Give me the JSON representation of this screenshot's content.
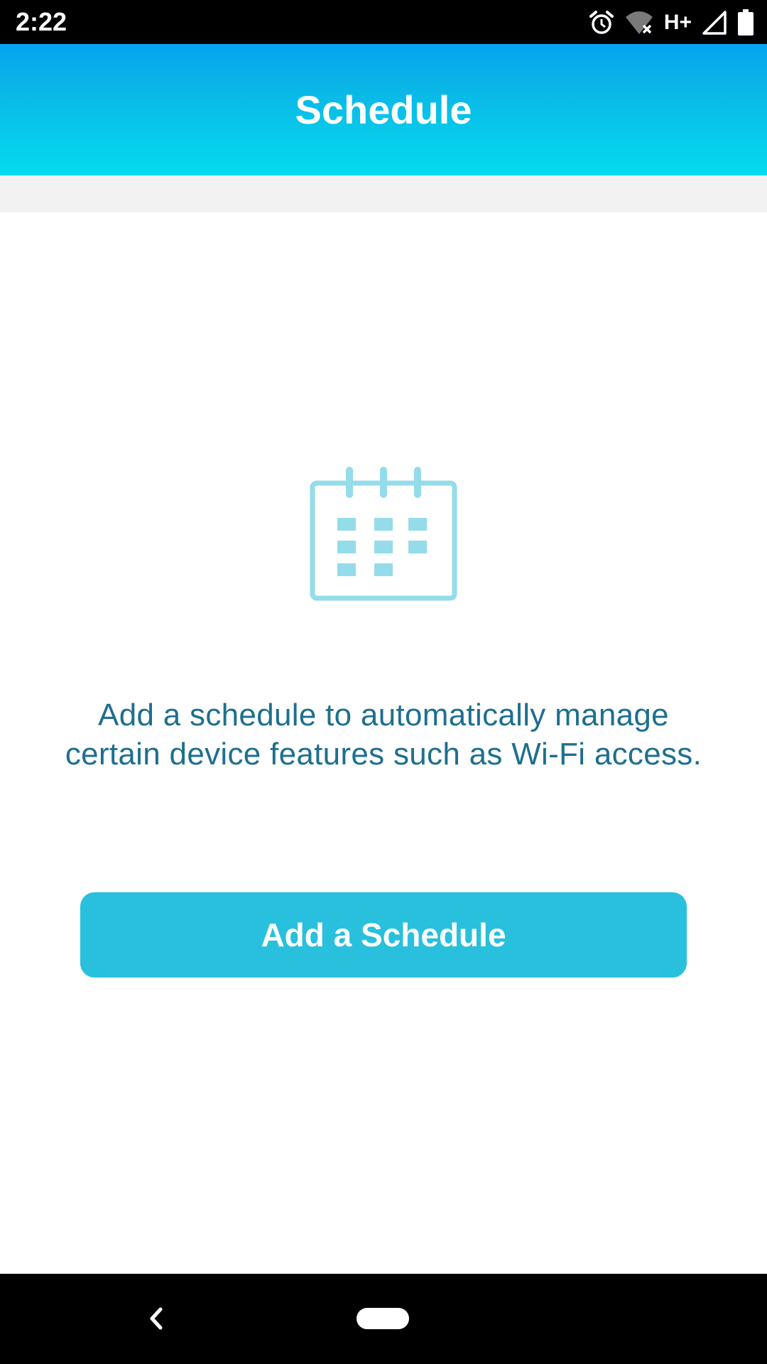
{
  "status_bar": {
    "time": "2:22",
    "network": "H+",
    "icons": [
      "alarm-icon",
      "wifi-off-icon",
      "signal-icon",
      "battery-icon"
    ]
  },
  "header": {
    "title": "Schedule"
  },
  "empty_state": {
    "icon": "calendar-icon",
    "message_line1": "Add a schedule to automatically manage",
    "message_line2": "certain device features such as Wi-Fi access."
  },
  "actions": {
    "add_schedule_label": "Add a Schedule"
  },
  "nav_bar": {
    "back_icon": "back-icon",
    "home_icon": "home-pill-icon"
  },
  "colors": {
    "header_top": "#03a4f1",
    "header_bottom": "#04dbef",
    "accent": "#28c0dd",
    "message_text": "#1e6f8e",
    "icon_light": "#94dcea"
  }
}
